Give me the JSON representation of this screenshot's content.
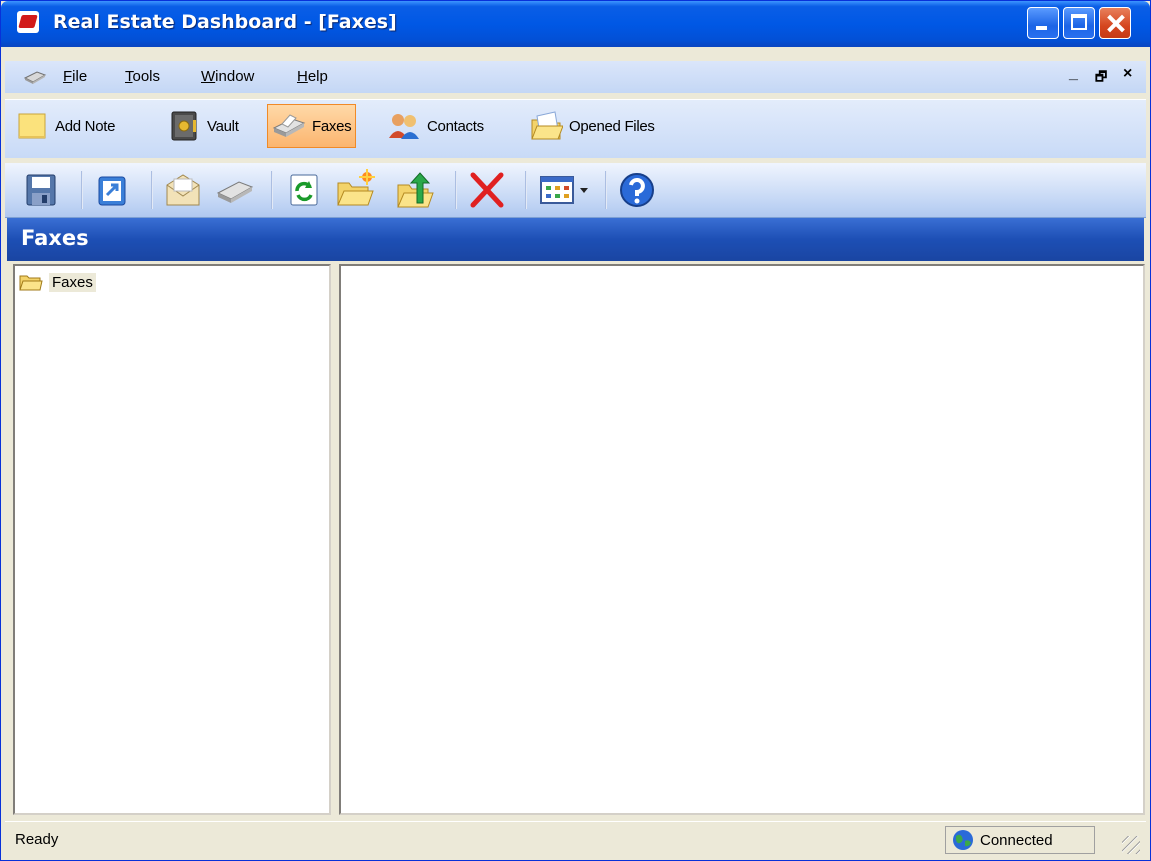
{
  "window": {
    "title": "Real Estate Dashboard - [Faxes]"
  },
  "menu": {
    "items": [
      {
        "label": "File",
        "accel": "F",
        "rest": "ile"
      },
      {
        "label": "Tools",
        "accel": "T",
        "rest": "ools"
      },
      {
        "label": "Window",
        "accel": "W",
        "rest": "indow"
      },
      {
        "label": "Help",
        "accel": "H",
        "rest": "elp"
      }
    ],
    "mdi_minimize": "_",
    "mdi_restore": "🗗",
    "mdi_close": "×"
  },
  "shortcuts": [
    {
      "label": "Add Note",
      "icon": "note-icon",
      "active": false
    },
    {
      "label": "Vault",
      "icon": "vault-icon",
      "active": false
    },
    {
      "label": "Faxes",
      "icon": "fax-icon",
      "active": true
    },
    {
      "label": "Contacts",
      "icon": "contacts-icon",
      "active": false
    },
    {
      "label": "Opened Files",
      "icon": "opened-files-icon",
      "active": false
    }
  ],
  "toolbar": {
    "buttons": [
      "save-icon",
      "export-icon",
      "email-icon",
      "fax-icon",
      "refresh-icon",
      "new-folder-icon",
      "up-folder-icon",
      "delete-icon",
      "view-columns-icon",
      "help-icon"
    ]
  },
  "panel": {
    "title": "Faxes"
  },
  "tree": {
    "root_label": "Faxes"
  },
  "status": {
    "text": "Ready",
    "connection": "Connected"
  },
  "colors": {
    "title_bar": "#0058e5",
    "header": "#1d4fb5",
    "active_shortcut": "#fbb56f",
    "delete_red": "#e02020"
  }
}
